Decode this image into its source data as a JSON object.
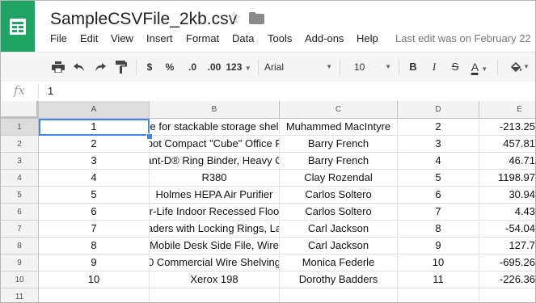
{
  "app": {
    "icon": "sheets-icon"
  },
  "doc": {
    "title": "SampleCSVFile_2kb.csv",
    "star_icon": "star-icon",
    "folder_icon": "folder-icon"
  },
  "menu": [
    "File",
    "Edit",
    "View",
    "Insert",
    "Format",
    "Data",
    "Tools",
    "Add-ons",
    "Help"
  ],
  "last_edit": "Last edit was on February 22",
  "toolbar": {
    "print_icon": "print-icon",
    "undo_icon": "undo-icon",
    "redo_icon": "redo-icon",
    "paint_format_icon": "paint-format-icon",
    "currency": "$",
    "percent": "%",
    "dec_less": ".0",
    "dec_more": ".00",
    "more_formats": "123",
    "font": "Arial",
    "font_size": "10",
    "bold": "B",
    "italic": "I",
    "strike": "S",
    "text_color": "A",
    "fill_icon": "fill-color-icon"
  },
  "formula_bar": {
    "fx": "fx",
    "value": "1"
  },
  "columns": [
    "A",
    "B",
    "C",
    "D",
    "E"
  ],
  "rows": [
    {
      "num": "1",
      "a": "1",
      "b": "e for stackable storage shel",
      "c": "Muhammed MacIntyre",
      "d": "2",
      "e": "-213.25"
    },
    {
      "num": "2",
      "a": "2",
      "b": "bot Compact \"Cube\" Office F",
      "c": "Barry French",
      "d": "3",
      "e": "457.81"
    },
    {
      "num": "3",
      "a": "3",
      "b": "ant-D® Ring Binder, Heavy C",
      "c": "Barry French",
      "d": "4",
      "e": "46.71"
    },
    {
      "num": "4",
      "a": "4",
      "b": "R380",
      "c": "Clay Rozendal",
      "d": "5",
      "e": "1198.97"
    },
    {
      "num": "5",
      "a": "5",
      "b": "Holmes HEPA Air Purifier",
      "c": "Carlos Soltero",
      "d": "6",
      "e": "30.94"
    },
    {
      "num": "6",
      "a": "6",
      "b": "r-Life Indoor Recessed Floo",
      "c": "Carlos Soltero",
      "d": "7",
      "e": "4.43"
    },
    {
      "num": "7",
      "a": "7",
      "b": "aders with Locking Rings, La",
      "c": "Carl Jackson",
      "d": "8",
      "e": "-54.04"
    },
    {
      "num": "8",
      "a": "8",
      "b": "Mobile Desk Side File, Wire",
      "c": "Carl Jackson",
      "d": "9",
      "e": "127.7"
    },
    {
      "num": "9",
      "a": "9",
      "b": "0 Commercial Wire Shelving",
      "c": "Monica Federle",
      "d": "10",
      "e": "-695.26"
    },
    {
      "num": "10",
      "a": "10",
      "b": "Xerox 198",
      "c": "Dorothy Badders",
      "d": "11",
      "e": "-226.36"
    },
    {
      "num": "11",
      "a": "",
      "b": "",
      "c": "",
      "d": "",
      "e": ""
    }
  ],
  "colors": {
    "brand": "#1fa463",
    "selection": "#4285f4"
  }
}
